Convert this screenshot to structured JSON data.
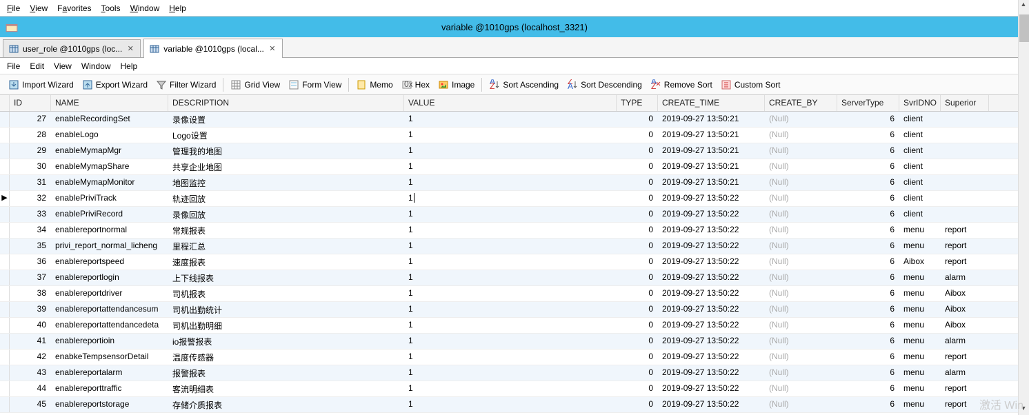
{
  "main_menu": [
    "File",
    "View",
    "Favorites",
    "Tools",
    "Window",
    "Help"
  ],
  "title": "variable @1010gps (localhost_3321)",
  "tabs": [
    {
      "label": "user_role @1010gps (loc...",
      "active": false
    },
    {
      "label": "variable @1010gps (local...",
      "active": true
    }
  ],
  "sub_menu": [
    "File",
    "Edit",
    "View",
    "Window",
    "Help"
  ],
  "toolbar": {
    "import": "Import Wizard",
    "export": "Export Wizard",
    "filter": "Filter Wizard",
    "grid": "Grid View",
    "form": "Form View",
    "memo": "Memo",
    "hex": "Hex",
    "image": "Image",
    "sort_asc": "Sort Ascending",
    "sort_desc": "Sort Descending",
    "sort_remove": "Remove Sort",
    "sort_custom": "Custom Sort"
  },
  "columns": [
    "ID",
    "NAME",
    "DESCRIPTION",
    "VALUE",
    "TYPE",
    "CREATE_TIME",
    "CREATE_BY",
    "ServerType",
    "SvrIDNO",
    "Superior"
  ],
  "null_text": "(Null)",
  "current_row_index": 5,
  "rows": [
    {
      "id": 27,
      "name": "enableRecordingSet",
      "desc": "录像设置",
      "value": "1",
      "type": 0,
      "ctime": "2019-09-27 13:50:21",
      "cby": null,
      "stype": 6,
      "sidno": "client",
      "sup": ""
    },
    {
      "id": 28,
      "name": "enableLogo",
      "desc": "Logo设置",
      "value": "1",
      "type": 0,
      "ctime": "2019-09-27 13:50:21",
      "cby": null,
      "stype": 6,
      "sidno": "client",
      "sup": ""
    },
    {
      "id": 29,
      "name": "enableMymapMgr",
      "desc": "管理我的地图",
      "value": "1",
      "type": 0,
      "ctime": "2019-09-27 13:50:21",
      "cby": null,
      "stype": 6,
      "sidno": "client",
      "sup": ""
    },
    {
      "id": 30,
      "name": "enableMymapShare",
      "desc": "共享企业地图",
      "value": "1",
      "type": 0,
      "ctime": "2019-09-27 13:50:21",
      "cby": null,
      "stype": 6,
      "sidno": "client",
      "sup": ""
    },
    {
      "id": 31,
      "name": "enableMymapMonitor",
      "desc": "地图监控",
      "value": "1",
      "type": 0,
      "ctime": "2019-09-27 13:50:21",
      "cby": null,
      "stype": 6,
      "sidno": "client",
      "sup": ""
    },
    {
      "id": 32,
      "name": "enablePriviTrack",
      "desc": "轨迹回放",
      "value": "1",
      "type": 0,
      "ctime": "2019-09-27 13:50:22",
      "cby": null,
      "stype": 6,
      "sidno": "client",
      "sup": ""
    },
    {
      "id": 33,
      "name": "enablePriviRecord",
      "desc": "录像回放",
      "value": "1",
      "type": 0,
      "ctime": "2019-09-27 13:50:22",
      "cby": null,
      "stype": 6,
      "sidno": "client",
      "sup": ""
    },
    {
      "id": 34,
      "name": "enablereportnormal",
      "desc": "常规报表",
      "value": "1",
      "type": 0,
      "ctime": "2019-09-27 13:50:22",
      "cby": null,
      "stype": 6,
      "sidno": "menu",
      "sup": "report"
    },
    {
      "id": 35,
      "name": "privi_report_normal_licheng",
      "desc": "里程汇总",
      "value": "1",
      "type": 0,
      "ctime": "2019-09-27 13:50:22",
      "cby": null,
      "stype": 6,
      "sidno": "menu",
      "sup": "report"
    },
    {
      "id": 36,
      "name": "enablereportspeed",
      "desc": "速度报表",
      "value": "1",
      "type": 0,
      "ctime": "2019-09-27 13:50:22",
      "cby": null,
      "stype": 6,
      "sidno": "Aibox",
      "sup": "report"
    },
    {
      "id": 37,
      "name": "enablereportlogin",
      "desc": "上下线报表",
      "value": "1",
      "type": 0,
      "ctime": "2019-09-27 13:50:22",
      "cby": null,
      "stype": 6,
      "sidno": "menu",
      "sup": "alarm"
    },
    {
      "id": 38,
      "name": "enablereportdriver",
      "desc": "司机报表",
      "value": "1",
      "type": 0,
      "ctime": "2019-09-27 13:50:22",
      "cby": null,
      "stype": 6,
      "sidno": "menu",
      "sup": "Aibox"
    },
    {
      "id": 39,
      "name": "enablereportattendancesum",
      "desc": "司机出勤统计",
      "value": "1",
      "type": 0,
      "ctime": "2019-09-27 13:50:22",
      "cby": null,
      "stype": 6,
      "sidno": "menu",
      "sup": "Aibox"
    },
    {
      "id": 40,
      "name": "enablereportattendancedeta",
      "desc": "司机出勤明细",
      "value": "1",
      "type": 0,
      "ctime": "2019-09-27 13:50:22",
      "cby": null,
      "stype": 6,
      "sidno": "menu",
      "sup": "Aibox"
    },
    {
      "id": 41,
      "name": "enablereportioin",
      "desc": "io报警报表",
      "value": "1",
      "type": 0,
      "ctime": "2019-09-27 13:50:22",
      "cby": null,
      "stype": 6,
      "sidno": "menu",
      "sup": "alarm"
    },
    {
      "id": 42,
      "name": "enabkeTempsensorDetail",
      "desc": "温度传感器",
      "value": "1",
      "type": 0,
      "ctime": "2019-09-27 13:50:22",
      "cby": null,
      "stype": 6,
      "sidno": "menu",
      "sup": "report"
    },
    {
      "id": 43,
      "name": "enablereportalarm",
      "desc": "报警报表",
      "value": "1",
      "type": 0,
      "ctime": "2019-09-27 13:50:22",
      "cby": null,
      "stype": 6,
      "sidno": "menu",
      "sup": "alarm"
    },
    {
      "id": 44,
      "name": "enablereporttraffic",
      "desc": "客流明细表",
      "value": "1",
      "type": 0,
      "ctime": "2019-09-27 13:50:22",
      "cby": null,
      "stype": 6,
      "sidno": "menu",
      "sup": "report"
    },
    {
      "id": 45,
      "name": "enablereportstorage",
      "desc": "存储介质报表",
      "value": "1",
      "type": 0,
      "ctime": "2019-09-27 13:50:22",
      "cby": null,
      "stype": 6,
      "sidno": "menu",
      "sup": "report"
    }
  ],
  "watermark": "激活 Win"
}
